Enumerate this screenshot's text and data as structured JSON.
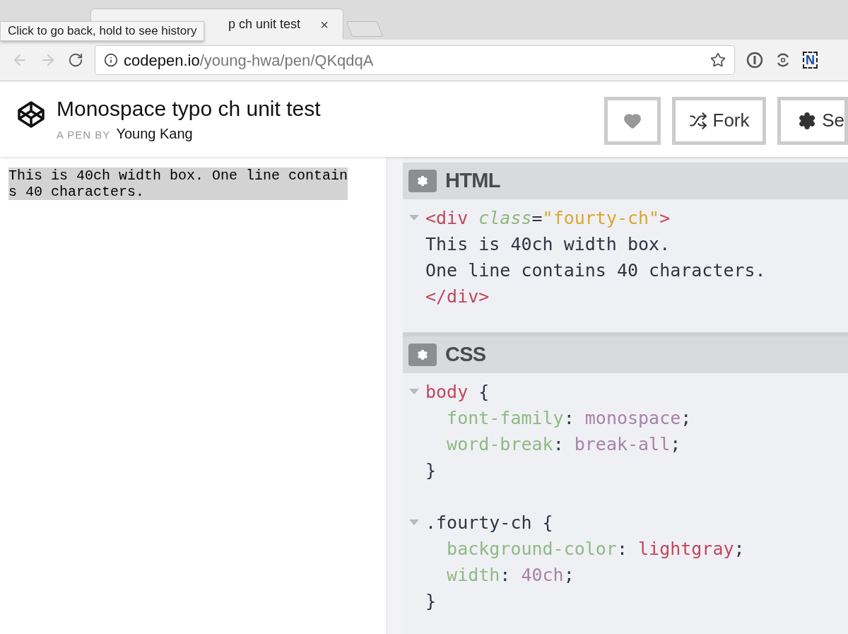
{
  "browser": {
    "tab": {
      "title": "p ch unit test",
      "close": "×"
    },
    "tooltip": "Click to go back, hold to see history",
    "url": {
      "host": "codepen.io",
      "path": "/young-hwa/pen/QKqdqA"
    },
    "extension_badge": "N"
  },
  "pen": {
    "title": "Monospace typo ch unit test",
    "byline_label": "A PEN BY",
    "author": "Young Kang",
    "buttons": [
      {
        "kind": "heart"
      },
      {
        "kind": "fork",
        "label": "Fork"
      },
      {
        "kind": "settings",
        "label": "Se"
      }
    ]
  },
  "preview": {
    "text": "This is 40ch width box. One line contains 40 characters."
  },
  "editors": [
    {
      "title": "HTML",
      "lines": [
        {
          "foldable": true,
          "tokens": [
            {
              "kind": "tag",
              "text": "<div "
            },
            {
              "kind": "attr",
              "text": "class"
            },
            {
              "kind": "plain",
              "text": "="
            },
            {
              "kind": "string",
              "text": "\"fourty-ch\""
            },
            {
              "kind": "tag",
              "text": ">"
            }
          ]
        },
        {
          "foldable": false,
          "tokens": [
            {
              "kind": "plain",
              "text": "This is 40ch width box."
            }
          ]
        },
        {
          "foldable": false,
          "tokens": [
            {
              "kind": "plain",
              "text": "One line contains 40 characters."
            }
          ]
        },
        {
          "foldable": false,
          "tokens": [
            {
              "kind": "tag",
              "text": "</div>"
            }
          ]
        }
      ]
    },
    {
      "title": "CSS",
      "lines": [
        {
          "foldable": true,
          "tokens": [
            {
              "kind": "selector",
              "text": "body"
            },
            {
              "kind": "plain",
              "text": " {"
            }
          ]
        },
        {
          "foldable": false,
          "tokens": [
            {
              "kind": "prop",
              "text": "  font-family"
            },
            {
              "kind": "plain",
              "text": ": "
            },
            {
              "kind": "value",
              "text": "monospace"
            },
            {
              "kind": "plain",
              "text": ";"
            }
          ]
        },
        {
          "foldable": false,
          "tokens": [
            {
              "kind": "prop",
              "text": "  word-break"
            },
            {
              "kind": "plain",
              "text": ": "
            },
            {
              "kind": "value",
              "text": "break-all"
            },
            {
              "kind": "plain",
              "text": ";"
            }
          ]
        },
        {
          "foldable": false,
          "tokens": [
            {
              "kind": "plain",
              "text": "}"
            }
          ]
        },
        {
          "foldable": false
        },
        {
          "foldable": true,
          "tokens": [
            {
              "kind": "plain",
              "text": ".fourty-ch {"
            }
          ]
        },
        {
          "foldable": false,
          "tokens": [
            {
              "kind": "prop",
              "text": "  background-color"
            },
            {
              "kind": "plain",
              "text": ": "
            },
            {
              "kind": "keyword",
              "text": "lightgray"
            },
            {
              "kind": "plain",
              "text": ";"
            }
          ]
        },
        {
          "foldable": false,
          "tokens": [
            {
              "kind": "prop",
              "text": "  width"
            },
            {
              "kind": "plain",
              "text": ": "
            },
            {
              "kind": "value",
              "text": "40ch"
            },
            {
              "kind": "plain",
              "text": ";"
            }
          ]
        },
        {
          "foldable": false,
          "tokens": [
            {
              "kind": "plain",
              "text": "}"
            }
          ]
        }
      ]
    }
  ]
}
